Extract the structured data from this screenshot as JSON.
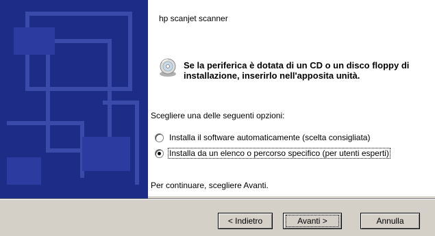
{
  "dialog": {
    "heading": "hp scanjet scanner",
    "message": "Se la periferica è dotata di un CD o un disco floppy di installazione, inserirlo nell'apposita unità.",
    "instruction": "Scegliere una delle seguenti opzioni:",
    "options": [
      {
        "label": "Installa il software automaticamente (scelta consigliata)",
        "selected": false
      },
      {
        "label": "Installa da un elenco o percorso specifico (per utenti esperti)",
        "selected": true
      }
    ],
    "continue_text": "Per continuare, scegliere Avanti."
  },
  "buttons": {
    "back": "< Indietro",
    "next": "Avanti >",
    "cancel": "Annulla"
  },
  "icons": {
    "cd": "cd-icon"
  },
  "colors": {
    "side_panel": "#1d2c86",
    "dialog_bg": "#d4d0c8",
    "content_bg": "#ffffff"
  }
}
